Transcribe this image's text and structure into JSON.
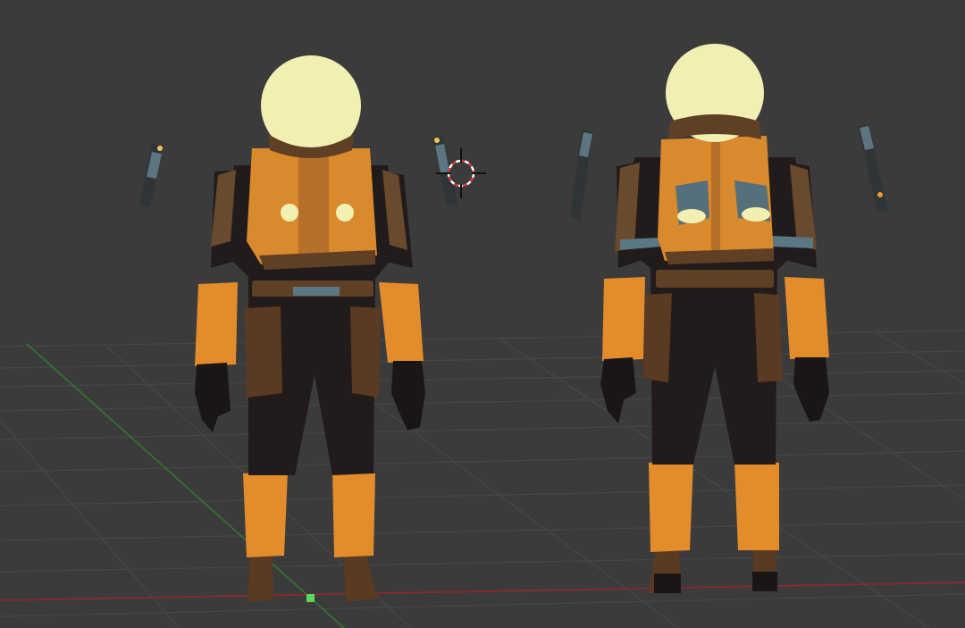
{
  "viewport": {
    "background": "#3b3b3b",
    "grid_color": "#4a4a4a",
    "x_axis_color": "#8a2a2a",
    "y_axis_color": "#2f7a2f"
  },
  "scene": {
    "objects": [
      {
        "name": "astronaut-back-view",
        "icon": "character-model"
      },
      {
        "name": "astronaut-back-view-lit",
        "icon": "character-model"
      },
      {
        "name": "3d-cursor",
        "icon": "crosshair-icon"
      },
      {
        "name": "origin",
        "icon": "origin-point-icon"
      }
    ],
    "colors": {
      "suit_orange": "#d9892a",
      "helmet": "#f2efb3",
      "suit_black": "#221c1c",
      "leather_brown": "#5a3e25",
      "tank_blue": "#55707a"
    }
  }
}
